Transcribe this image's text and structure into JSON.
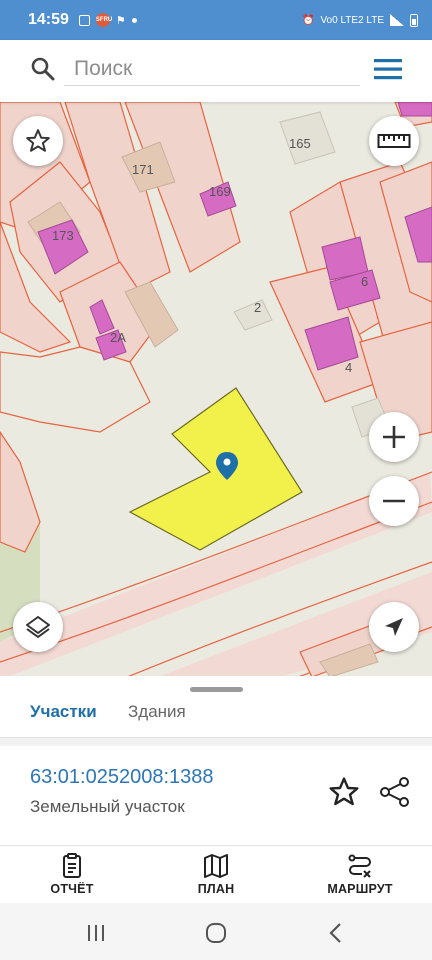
{
  "status_bar": {
    "time": "14:59",
    "left_badge": "SFRU",
    "right_text": "Vo0 LTE2 LTE"
  },
  "search": {
    "placeholder": "Поиск",
    "value": ""
  },
  "map": {
    "parcel_numbers": [
      "165",
      "171",
      "169",
      "173",
      "2",
      "6",
      "4",
      "2А"
    ]
  },
  "sheet": {
    "tabs": [
      {
        "label": "Участки",
        "active": true
      },
      {
        "label": "Здания",
        "active": false
      }
    ],
    "result": {
      "cadastral_number": "63:01:0252008:1388",
      "type": "Земельный участок"
    }
  },
  "bottom_nav": {
    "items": [
      {
        "label": "ОТЧЁТ",
        "icon": "report-icon"
      },
      {
        "label": "ПЛАН",
        "icon": "map-plan-icon"
      },
      {
        "label": "МАРШРУТ",
        "icon": "route-icon"
      }
    ]
  },
  "colors": {
    "accent": "#1f6fa8",
    "status_bar": "#4f8fd0",
    "selected_parcel": "#f2f04a",
    "parcel_outline": "#e8633f",
    "building": "#d66bc4"
  }
}
